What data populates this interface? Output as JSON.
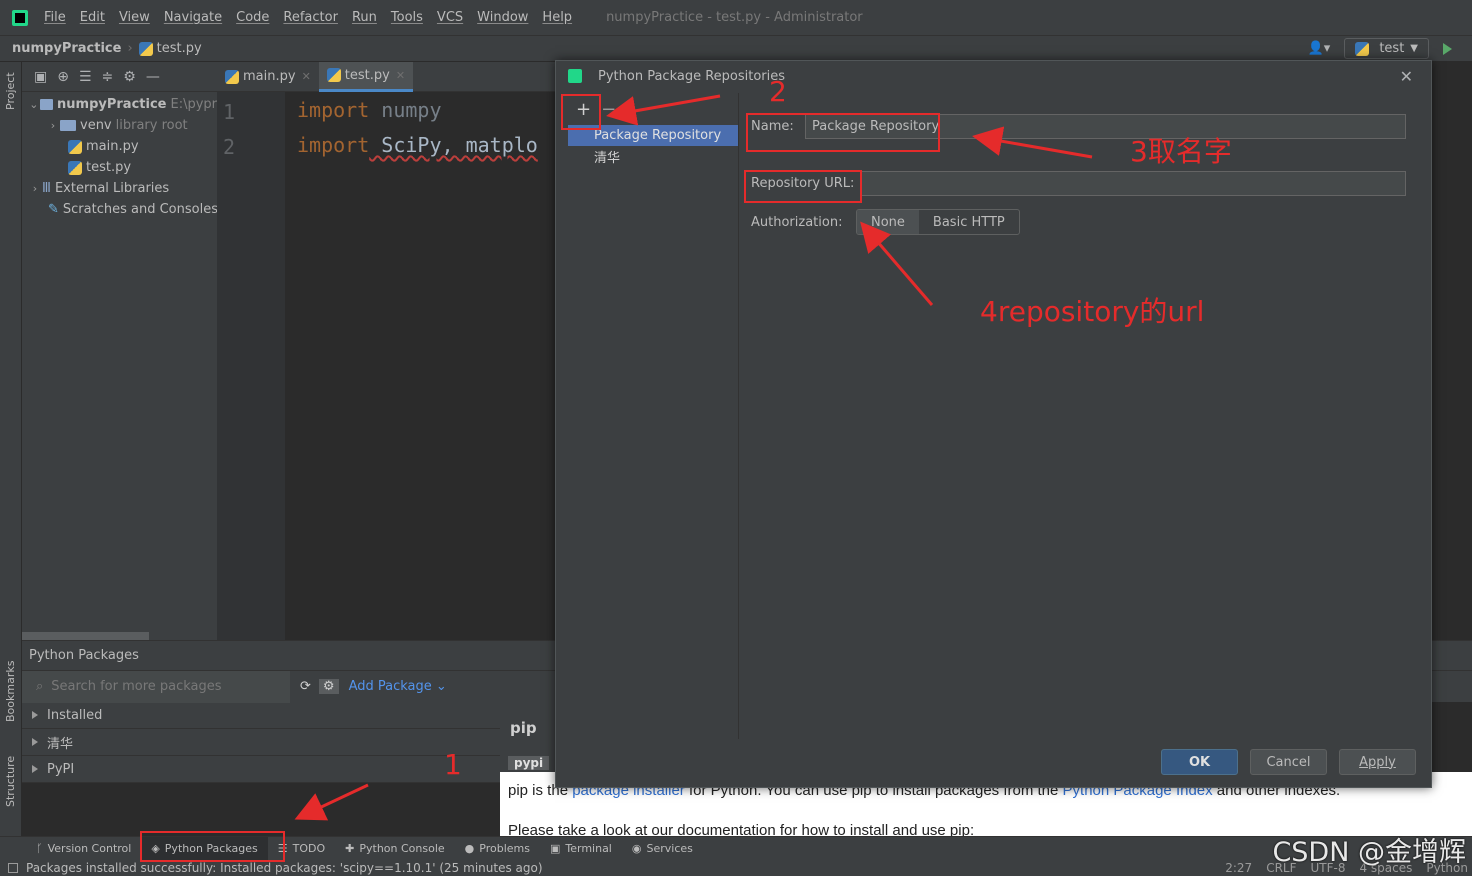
{
  "window": {
    "title": "numpyPractice - test.py - Administrator",
    "menu": [
      "File",
      "Edit",
      "View",
      "Navigate",
      "Code",
      "Refactor",
      "Run",
      "Tools",
      "VCS",
      "Window",
      "Help"
    ]
  },
  "navbar": {
    "project": "numpyPractice",
    "file": "test.py",
    "run_config": "test"
  },
  "sidebar": {
    "project_label": "Project",
    "bookmarks_label": "Bookmarks",
    "structure_label": "Structure"
  },
  "project_tree": {
    "items": [
      {
        "label": "numpyPractice",
        "hint": "E:\\pypr"
      },
      {
        "label": "venv",
        "hint": "library root"
      },
      {
        "label": "main.py"
      },
      {
        "label": "test.py"
      },
      {
        "label": "External Libraries"
      },
      {
        "label": "Scratches and Consoles"
      }
    ]
  },
  "editor": {
    "tabs": [
      {
        "label": "main.py"
      },
      {
        "label": "test.py"
      }
    ],
    "line_numbers": [
      "1",
      "2"
    ],
    "lines": [
      {
        "keyword": "import",
        "text": " numpy"
      },
      {
        "keyword": "import",
        "text": " SciPy, matplo"
      }
    ]
  },
  "packages": {
    "title": "Python Packages",
    "search_placeholder": "Search for more packages",
    "add_package": "Add Package",
    "groups": [
      "Installed",
      "清华",
      "PyPI"
    ],
    "detail": {
      "name": "pip",
      "badge": "pypi",
      "desc_parts": [
        "pip is the ",
        "package installer",
        " for Python. You can use pip to install packages from the ",
        "Python Package Index",
        " and other indexes."
      ],
      "doc_text": "Please take a look at our documentation for how to install and use pip:"
    }
  },
  "dialog": {
    "title": "Python Package Repositories",
    "add_symbol": "+",
    "remove_symbol": "−",
    "repos": [
      "Package Repository",
      "清华"
    ],
    "name_label": "Name:",
    "name_value": "Package Repository",
    "url_label": "Repository URL:",
    "url_value": "",
    "auth_label": "Authorization:",
    "auth_options": [
      "None",
      "Basic HTTP"
    ],
    "ok": "OK",
    "cancel": "Cancel",
    "apply": "Apply"
  },
  "tool_tabs": [
    "Version Control",
    "Python Packages",
    "TODO",
    "Python Console",
    "Problems",
    "Terminal",
    "Services"
  ],
  "status": {
    "message": "Packages installed successfully: Installed packages: 'scipy==1.10.1' (25 minutes ago)",
    "right": [
      "2:27",
      "CRLF",
      "UTF-8",
      "4 spaces",
      "Python"
    ]
  },
  "annotations": {
    "a1": "1",
    "a2": "2",
    "a3": "3取名字",
    "a4": "4repository的url"
  },
  "watermark": "CSDN @金增辉",
  "colors": {
    "annotation": "#e52b2b",
    "selection": "#4b6eaf",
    "primary_button": "#365880"
  }
}
